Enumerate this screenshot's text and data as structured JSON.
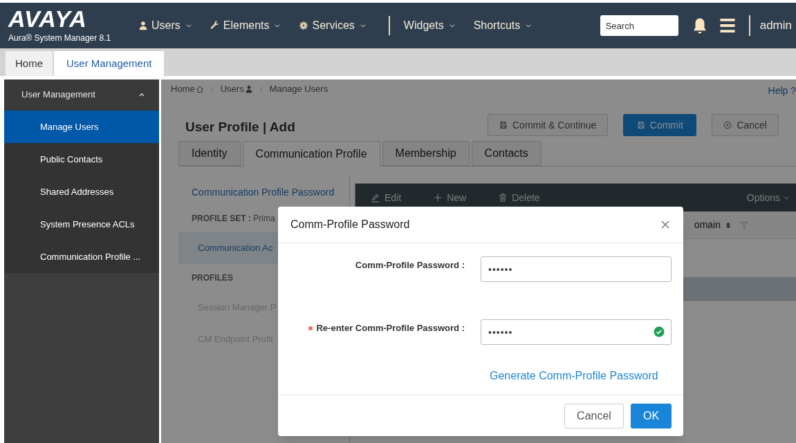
{
  "header": {
    "logo": "AVAYA",
    "product": "Aura® System Manager 8.1",
    "nav": [
      {
        "label": "Users"
      },
      {
        "label": "Elements"
      },
      {
        "label": "Services"
      },
      {
        "label": "Widgets"
      },
      {
        "label": "Shortcuts"
      }
    ],
    "search": {
      "placeholder": "Search"
    },
    "user": "admin"
  },
  "tabs": [
    {
      "label": "Home",
      "selected": false
    },
    {
      "label": "User Management",
      "selected": true
    }
  ],
  "sidebar": {
    "section": "User Management",
    "expanded": true,
    "items": [
      {
        "label": "Manage Users",
        "selected": true
      },
      {
        "label": "Public Contacts",
        "selected": false
      },
      {
        "label": "Shared Addresses",
        "selected": false
      },
      {
        "label": "System Presence ACLs",
        "selected": false
      },
      {
        "label": "Communication Profile ...",
        "selected": false
      }
    ]
  },
  "breadcrumb": [
    {
      "label": "Home"
    },
    {
      "label": "Users"
    },
    {
      "label": "Manage Users"
    }
  ],
  "help": "Help ?",
  "page": {
    "title": "User Profile | Add",
    "actions": [
      {
        "label": "Commit & Continue",
        "primary": false
      },
      {
        "label": "Commit",
        "primary": true
      },
      {
        "label": "Cancel",
        "primary": false
      }
    ],
    "tabs": [
      {
        "label": "Identity",
        "selected": false
      },
      {
        "label": "Communication Profile",
        "selected": true
      },
      {
        "label": "Membership",
        "selected": false
      },
      {
        "label": "Contacts",
        "selected": false
      }
    ]
  },
  "profile_nav": [
    {
      "kind": "link",
      "label": "Communication Profile Password"
    },
    {
      "kind": "heading",
      "label": "**PROFILE SET :** Prima"
    },
    {
      "kind": "item",
      "label": "Communication Ac",
      "selected": true
    },
    {
      "kind": "title",
      "label": "PROFILES"
    },
    {
      "kind": "item",
      "label": "Session Manager P",
      "selected": false
    },
    {
      "kind": "item",
      "label": "CM Endpoint Profil",
      "selected": false
    }
  ],
  "grid": {
    "toolbar": [
      {
        "label": "Edit"
      },
      {
        "label": "New"
      },
      {
        "label": "Delete"
      }
    ],
    "options": "Options",
    "column_header": "omain"
  },
  "dialog": {
    "title": "Comm-Profile Password",
    "fields": [
      {
        "label": "Comm-Profile Password :",
        "value": "••••••",
        "required": false,
        "valid": false
      },
      {
        "label": "Re-enter Comm-Profile Password :",
        "value": "••••••",
        "required": true,
        "valid": true
      }
    ],
    "link": "Generate Comm-Profile Password",
    "buttons": [
      {
        "label": "Cancel",
        "primary": false
      },
      {
        "label": "OK",
        "primary": true
      }
    ]
  }
}
